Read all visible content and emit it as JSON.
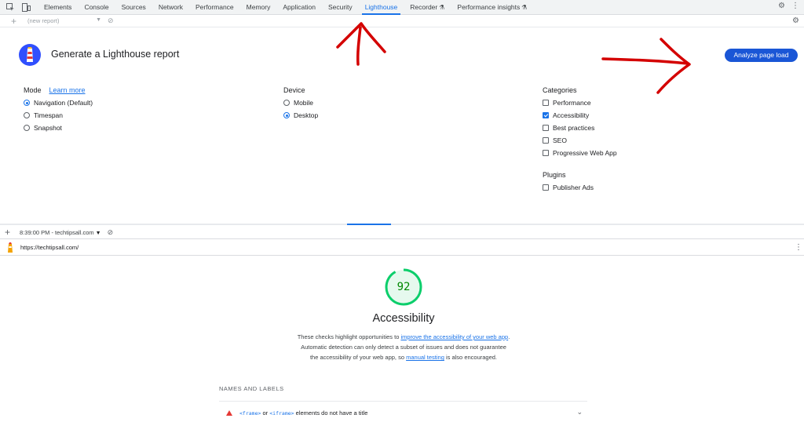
{
  "tabbar": {
    "tabs": [
      {
        "label": "Elements",
        "active": false
      },
      {
        "label": "Console",
        "active": false
      },
      {
        "label": "Sources",
        "active": false
      },
      {
        "label": "Network",
        "active": false
      },
      {
        "label": "Performance",
        "active": false
      },
      {
        "label": "Memory",
        "active": false
      },
      {
        "label": "Application",
        "active": false
      },
      {
        "label": "Security",
        "active": false
      },
      {
        "label": "Lighthouse",
        "active": true
      },
      {
        "label": "Recorder",
        "active": false,
        "experimental": true
      },
      {
        "label": "Performance insights",
        "active": false,
        "experimental": true
      }
    ],
    "icons": [
      "inspect-element-icon",
      "device-toolbar-icon",
      "settings-gear-icon",
      "more-vert-icon"
    ]
  },
  "subbar": {
    "report_placeholder": "(new report)"
  },
  "header": {
    "title": "Generate a Lighthouse report",
    "analyze_label": "Analyze page load"
  },
  "mode": {
    "heading": "Mode",
    "learn_more": "Learn more",
    "options": [
      "Navigation (Default)",
      "Timespan",
      "Snapshot"
    ],
    "selected": 0
  },
  "device": {
    "heading": "Device",
    "options": [
      "Mobile",
      "Desktop"
    ],
    "selected": 1
  },
  "categories": {
    "heading": "Categories",
    "options": [
      "Performance",
      "Accessibility",
      "Best practices",
      "SEO",
      "Progressive Web App"
    ],
    "checked": [
      false,
      true,
      false,
      false,
      false
    ]
  },
  "plugins": {
    "heading": "Plugins",
    "options": [
      "Publisher Ads"
    ],
    "checked": [
      false
    ]
  },
  "report": {
    "selector": "8:39:00 PM - techtipsall.com",
    "url": "https://techtipsall.com/",
    "score": 92,
    "score_fraction": 0.92,
    "score_color": "#0cce6b",
    "category_title": "Accessibility",
    "desc_before": "These checks highlight opportunities to ",
    "desc_link1": "improve the accessibility of your web app",
    "desc_middle": ". Automatic detection can only detect a subset of issues and does not guarantee the accessibility of your web app, so ",
    "desc_link2": "manual testing",
    "desc_after": " is also encouraged.",
    "group_title": "NAMES AND LABELS",
    "audit": {
      "code1": "<frame>",
      "or": " or ",
      "code2": "<iframe>",
      "rest": " elements do not have a title"
    }
  },
  "colors": {
    "accent": "#1a73e8",
    "button": "#1a56d6",
    "annotation": "#d40000",
    "fail": "#e53935"
  }
}
